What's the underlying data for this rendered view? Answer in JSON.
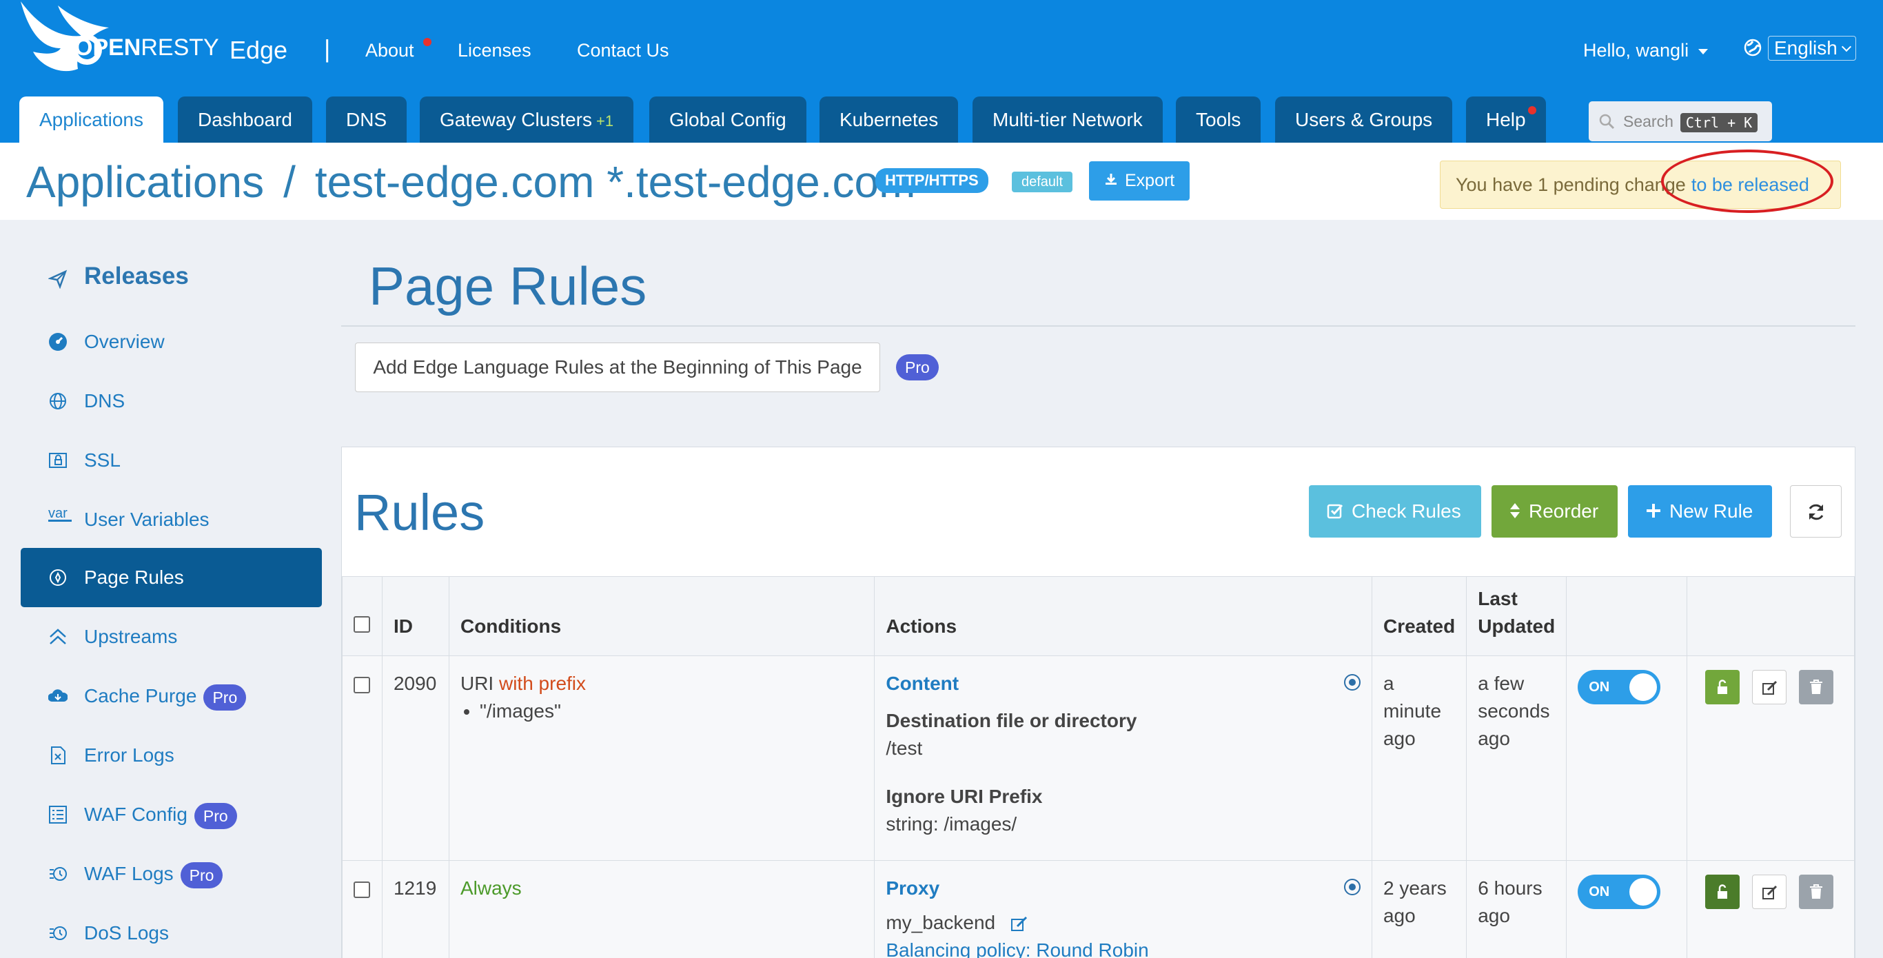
{
  "brand": {
    "logo_open": "OPEN",
    "logo_resty": "RESTY",
    "product": "Edge",
    "separator": "|"
  },
  "topnav": {
    "about": "About",
    "licenses": "Licenses",
    "contact": "Contact Us",
    "greeting": "Hello, wangli",
    "language": "English"
  },
  "tabs": [
    {
      "label": "Applications"
    },
    {
      "label": "Dashboard"
    },
    {
      "label": "DNS"
    },
    {
      "label": "Gateway Clusters",
      "extra": "+1"
    },
    {
      "label": "Global Config"
    },
    {
      "label": "Kubernetes"
    },
    {
      "label": "Multi-tier Network"
    },
    {
      "label": "Tools"
    },
    {
      "label": "Users & Groups"
    },
    {
      "label": "Help"
    }
  ],
  "search": {
    "placeholder": "Search",
    "shortcut": "Ctrl + K"
  },
  "breadcrumb": {
    "root": "Applications",
    "separator": "/",
    "app": "test-edge.com *.test-edge.com",
    "protocol_badge": "HTTP/HTTPS",
    "partition_badge": "default",
    "export_label": "Export"
  },
  "pending": {
    "text": "You have 1 pending change",
    "link": "to be released"
  },
  "sidebar": {
    "heading": "Releases",
    "items": [
      {
        "label": "Overview"
      },
      {
        "label": "DNS"
      },
      {
        "label": "SSL"
      },
      {
        "label": "User Variables",
        "icon_text": "var"
      },
      {
        "label": "Page Rules"
      },
      {
        "label": "Upstreams"
      },
      {
        "label": "Cache Purge",
        "badge": "Pro"
      },
      {
        "label": "Error Logs"
      },
      {
        "label": "WAF Config",
        "badge": "Pro"
      },
      {
        "label": "WAF Logs",
        "badge": "Pro"
      },
      {
        "label": "DoS Logs"
      }
    ]
  },
  "main": {
    "title": "Page Rules",
    "add_edge_lang": "Add Edge Language Rules at the Beginning of This Page",
    "pro": "Pro",
    "rules_title": "Rules",
    "buttons": {
      "check": "Check Rules",
      "reorder": "Reorder",
      "new_rule": "New Rule"
    }
  },
  "table": {
    "headers": {
      "id": "ID",
      "conditions": "Conditions",
      "actions": "Actions",
      "created": "Created",
      "updated": "Last Updated"
    },
    "rows": [
      {
        "id": "2090",
        "cond_var": "URI",
        "cond_op": "with prefix",
        "cond_value": "\"/images\"",
        "action": "Content",
        "field1_label": "Destination file or directory",
        "field1_value": "/test",
        "field2_label": "Ignore URI Prefix",
        "field2_value": "string: /images/",
        "created": "a minute ago",
        "updated": "a few seconds ago",
        "toggle": "ON"
      },
      {
        "id": "1219",
        "cond_always": "Always",
        "action": "Proxy",
        "backend": "my_backend",
        "policy": "Balancing policy: Round Robin",
        "created": "2 years ago",
        "updated": "6 hours ago",
        "toggle": "ON"
      }
    ]
  },
  "colors": {
    "topbar": "#0b86e0",
    "tab_dark": "#0a5b94",
    "heading_blue": "#2c76b0",
    "link_blue": "#1f7cc1",
    "pro_badge": "#5060d6",
    "green": "#72a73b",
    "annotation_red": "#d81f22"
  }
}
